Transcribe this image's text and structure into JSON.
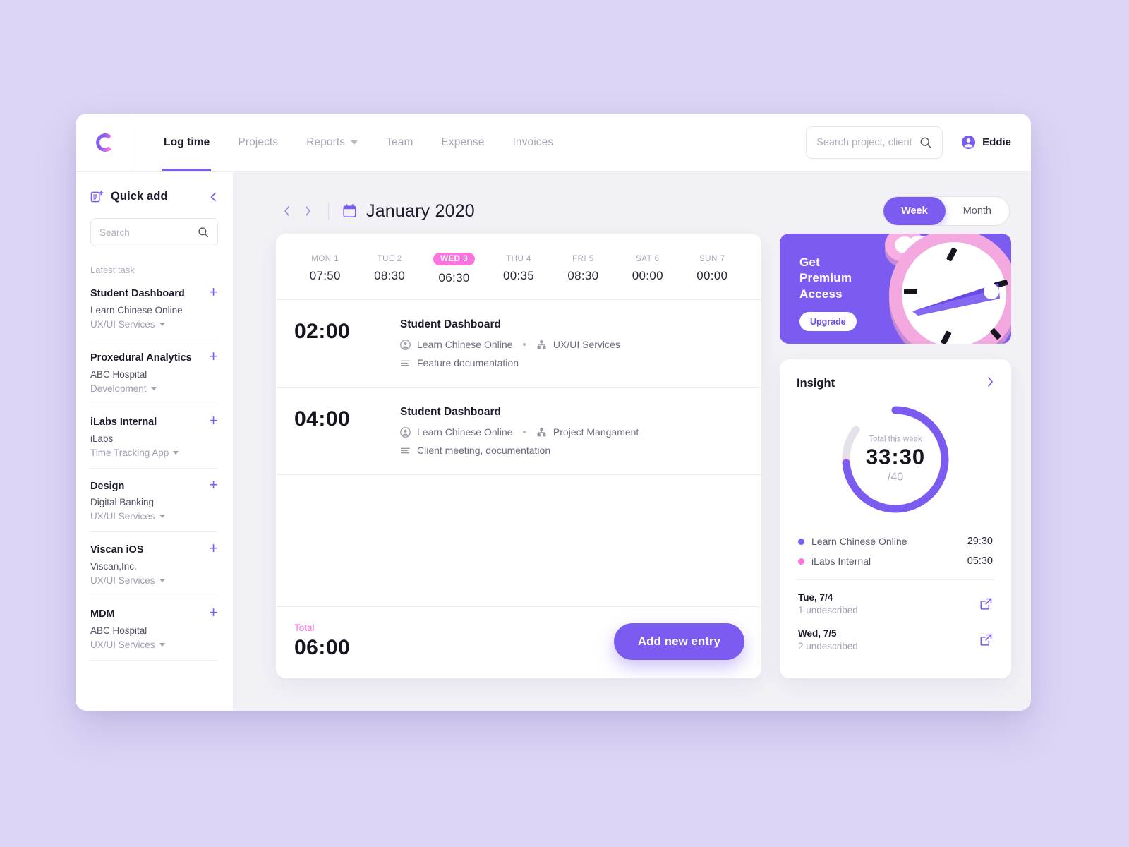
{
  "topnav": {
    "logo_text": "C",
    "links": [
      {
        "label": "Log time",
        "active": true,
        "dropdown": false
      },
      {
        "label": "Projects",
        "active": false,
        "dropdown": false
      },
      {
        "label": "Reports",
        "active": false,
        "dropdown": true
      },
      {
        "label": "Team",
        "active": false,
        "dropdown": false
      },
      {
        "label": "Expense",
        "active": false,
        "dropdown": false
      },
      {
        "label": "Invoices",
        "active": false,
        "dropdown": false
      }
    ],
    "search_placeholder": "Search project, client",
    "search_value": "",
    "user_name": "Eddie"
  },
  "sidebar": {
    "title": "Quick add",
    "search_placeholder": "Search",
    "search_value": "",
    "section_label": "Latest task",
    "tasks": [
      {
        "name": "Student Dashboard",
        "client": "Learn Chinese Online",
        "category": "UX/UI Services"
      },
      {
        "name": "Proxedural Analytics",
        "client": "ABC Hospital",
        "category": "Development"
      },
      {
        "name": "iLabs Internal",
        "client": "iLabs",
        "category": "Time Tracking App"
      },
      {
        "name": "Design",
        "client": "Digital Banking",
        "category": "UX/UI Services"
      },
      {
        "name": "Viscan iOS",
        "client": "Viscan,Inc.",
        "category": "UX/UI Services"
      },
      {
        "name": "MDM",
        "client": "ABC Hospital",
        "category": "UX/UI Services"
      }
    ]
  },
  "main": {
    "month_title": "January 2020",
    "view_options": [
      {
        "label": "Week",
        "active": true
      },
      {
        "label": "Month",
        "active": false
      }
    ],
    "days": [
      {
        "label": "MON 1",
        "time": "07:50",
        "today": false
      },
      {
        "label": "TUE 2",
        "time": "08:30",
        "today": false
      },
      {
        "label": "WED 3",
        "time": "06:30",
        "today": true
      },
      {
        "label": "THU 4",
        "time": "00:35",
        "today": false
      },
      {
        "label": "FRI 5",
        "time": "08:30",
        "today": false
      },
      {
        "label": "SAT 6",
        "time": "00:00",
        "today": false
      },
      {
        "label": "SUN 7",
        "time": "00:00",
        "today": false
      }
    ],
    "entries": [
      {
        "duration": "02:00",
        "title": "Student Dashboard",
        "client": "Learn Chinese Online",
        "category": "UX/UI Services",
        "note": "Feature documentation"
      },
      {
        "duration": "04:00",
        "title": "Student Dashboard",
        "client": "Learn Chinese Online",
        "category": "Project Mangament",
        "note": "Client meeting, documentation"
      }
    ],
    "total_label": "Total",
    "total_value": "06:00",
    "add_entry_label": "Add new entry"
  },
  "premium": {
    "title": "Get\nPremium\nAccess",
    "cta_label": "Upgrade"
  },
  "insight": {
    "title": "Insight",
    "center_caption": "Total this week",
    "center_value": "33:30",
    "center_goal": "/40",
    "legend": [
      {
        "name": "Learn Chinese Online",
        "value": "29:30",
        "color": "#7c5cf0"
      },
      {
        "name": "iLabs Internal",
        "value": "05:30",
        "color": "#fc74e0"
      }
    ],
    "undescribed": [
      {
        "day": "Tue, 7/4",
        "sub": "1 undescribed"
      },
      {
        "day": "Wed, 7/5",
        "sub": "2 undescribed"
      }
    ]
  },
  "chart_data": {
    "type": "pie",
    "title": "Total this week",
    "categories": [
      "Learn Chinese Online",
      "iLabs Internal",
      "Remaining"
    ],
    "values": [
      29.5,
      5.5,
      5.0
    ],
    "value_labels": [
      "29:30",
      "05:30",
      ""
    ],
    "colors": [
      "#7c5cf0",
      "#fc74e0",
      "#e4e2e8"
    ],
    "total": 33.5,
    "total_label": "33:30",
    "goal": 40,
    "goal_label": "/40",
    "units": "hours",
    "legend_position": "below"
  },
  "colors": {
    "page_background": "#dcd5f5",
    "accent_purple": "#7c5cf0",
    "accent_pink": "#fc74e0",
    "canvas": "#f2f1f5",
    "track_gray": "#e4e2e8"
  }
}
